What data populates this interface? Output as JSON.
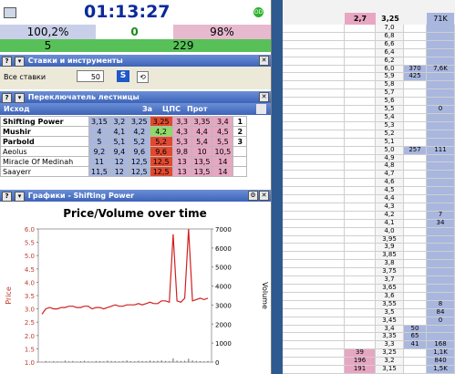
{
  "clock": "01:13:27",
  "stats": {
    "row1": [
      "100,2%",
      "0",
      "98%"
    ],
    "row2": [
      "5",
      "229"
    ]
  },
  "colors": {
    "panel_header": "#4a72c4",
    "blue_cell": "#a9b7df",
    "pink_cell": "#e7a6c2",
    "red_cell": "#e0492f",
    "green_cell": "#8fd86a",
    "green_bar": "#58c058"
  },
  "bets_panel": {
    "title": "Ставки и инструменты",
    "all_bets_label": "Все ставки",
    "stake": "50",
    "s_button": "S"
  },
  "ladder_panel": {
    "title": "Переключатель лестницы",
    "header": {
      "outcome": "Исход",
      "back": "За",
      "ltp": "ЦПС",
      "lay": "Прот"
    },
    "rows": [
      {
        "name": "Shifting Power",
        "bold": true,
        "vals": [
          "3,15",
          "3,2",
          "3,25",
          "3,25",
          "3,3",
          "3,35",
          "3,4"
        ],
        "rank": "1"
      },
      {
        "name": "Mushir",
        "bold": true,
        "vals": [
          "4",
          "4,1",
          "4,2",
          "4,2",
          "4,3",
          "4,4",
          "4,5"
        ],
        "rank": "2"
      },
      {
        "name": "Parbold",
        "bold": true,
        "vals": [
          "5",
          "5,1",
          "5,2",
          "5,2",
          "5,3",
          "5,4",
          "5,5"
        ],
        "rank": "3"
      },
      {
        "name": "Aeolus",
        "bold": false,
        "vals": [
          "9,2",
          "9,4",
          "9,6",
          "9,6",
          "9,8",
          "10",
          "10,5"
        ],
        "rank": ""
      },
      {
        "name": "Miracle Of Medinah",
        "bold": false,
        "vals": [
          "11",
          "12",
          "12,5",
          "12,5",
          "13",
          "13,5",
          "14"
        ],
        "rank": ""
      },
      {
        "name": "Saayerr",
        "bold": false,
        "vals": [
          "11,5",
          "12",
          "12,5",
          "12,5",
          "13",
          "13,5",
          "14"
        ],
        "rank": ""
      }
    ]
  },
  "graph_panel": {
    "title": "Графики - Shifting Power",
    "chart_title": "Price/Volume over time",
    "ylabel_left": "Price",
    "ylabel_right": "Volume",
    "left_ticks": [
      "6.0",
      "5.5",
      "5.0",
      "4.5",
      "4.0",
      "3.5",
      "3.0",
      "2.5",
      "2.0",
      "1.5",
      "1.0"
    ],
    "right_ticks": [
      "7000",
      "6000",
      "5000",
      "4000",
      "3000",
      "2000",
      "1000",
      "0"
    ]
  },
  "chart_data": {
    "type": "line",
    "title": "Price/Volume over time",
    "xlabel": "",
    "ylabel": "Price",
    "y2label": "Volume",
    "ylim": [
      1.0,
      6.0
    ],
    "y2lim": [
      0,
      7000
    ],
    "series": [
      {
        "name": "",
        "values": [
          2.8,
          3.0,
          3.05,
          3.0,
          3.0,
          3.05,
          3.05,
          3.1,
          3.1,
          3.05,
          3.05,
          3.1,
          3.1,
          3.0,
          3.05,
          3.05,
          3.0,
          3.05,
          3.1,
          3.15,
          3.1,
          3.1,
          3.15,
          3.15,
          3.15,
          3.2,
          3.15,
          3.2,
          3.25,
          3.2,
          3.2,
          3.3,
          3.3,
          3.25,
          5.8,
          3.3,
          3.25,
          3.4,
          6.0,
          3.3,
          3.35,
          3.4,
          3.35,
          3.4
        ]
      }
    ],
    "volume": [
      20,
      60,
      30,
      50,
      40,
      30,
      80,
      40,
      60,
      30,
      50,
      70,
      40,
      30,
      60,
      50,
      40,
      80,
      60,
      50,
      40,
      60,
      90,
      50,
      40,
      70,
      60,
      50,
      80,
      60,
      70,
      90,
      60,
      50,
      200,
      80,
      60,
      70,
      180,
      90,
      60,
      50,
      40,
      60
    ]
  },
  "right_grid": {
    "header": [
      "2,7",
      "3,25",
      "71K"
    ],
    "rows": [
      {
        "price": "7,0",
        "back": "",
        "vol": "",
        "tv": ""
      },
      {
        "price": "6,8",
        "back": "",
        "vol": "",
        "tv": ""
      },
      {
        "price": "6,6",
        "back": "",
        "vol": "",
        "tv": ""
      },
      {
        "price": "6,4",
        "back": "",
        "vol": "",
        "tv": ""
      },
      {
        "price": "6,2",
        "back": "",
        "vol": "",
        "tv": ""
      },
      {
        "price": "6,0",
        "back": "370",
        "vol": "7,6K",
        "tv": ""
      },
      {
        "price": "5,9",
        "back": "425",
        "vol": "",
        "tv": ""
      },
      {
        "price": "5,8",
        "back": "",
        "vol": "",
        "tv": ""
      },
      {
        "price": "5,7",
        "back": "",
        "vol": "",
        "tv": ""
      },
      {
        "price": "5,6",
        "back": "",
        "vol": "",
        "tv": ""
      },
      {
        "price": "5,5",
        "back": "",
        "vol": "0",
        "tv": ""
      },
      {
        "price": "5,4",
        "back": "",
        "vol": "",
        "tv": ""
      },
      {
        "price": "5,3",
        "back": "",
        "vol": "",
        "tv": ""
      },
      {
        "price": "5,2",
        "back": "",
        "vol": "",
        "tv": ""
      },
      {
        "price": "5,1",
        "back": "",
        "vol": "",
        "tv": ""
      },
      {
        "price": "5,0",
        "back": "257",
        "vol": "111",
        "tv": ""
      },
      {
        "price": "4,9",
        "back": "",
        "vol": "",
        "tv": ""
      },
      {
        "price": "4,8",
        "back": "",
        "vol": "",
        "tv": ""
      },
      {
        "price": "4,7",
        "back": "",
        "vol": "",
        "tv": ""
      },
      {
        "price": "4,6",
        "back": "",
        "vol": "",
        "tv": ""
      },
      {
        "price": "4,5",
        "back": "",
        "vol": "",
        "tv": ""
      },
      {
        "price": "4,4",
        "back": "",
        "vol": "",
        "tv": ""
      },
      {
        "price": "4,3",
        "back": "",
        "vol": "",
        "tv": ""
      },
      {
        "price": "4,2",
        "back": "",
        "vol": "7",
        "tv": ""
      },
      {
        "price": "4,1",
        "back": "",
        "vol": "34",
        "tv": ""
      },
      {
        "price": "4,0",
        "back": "",
        "vol": "",
        "tv": ""
      },
      {
        "price": "3,95",
        "back": "",
        "vol": "",
        "tv": ""
      },
      {
        "price": "3,9",
        "back": "",
        "vol": "",
        "tv": ""
      },
      {
        "price": "3,85",
        "back": "",
        "vol": "",
        "tv": ""
      },
      {
        "price": "3,8",
        "back": "",
        "vol": "",
        "tv": ""
      },
      {
        "price": "3,75",
        "back": "",
        "vol": "",
        "tv": ""
      },
      {
        "price": "3,7",
        "back": "",
        "vol": "",
        "tv": ""
      },
      {
        "price": "3,65",
        "back": "",
        "vol": "",
        "tv": ""
      },
      {
        "price": "3,6",
        "back": "",
        "vol": "",
        "tv": ""
      },
      {
        "price": "3,55",
        "back": "",
        "vol": "8",
        "tv": ""
      },
      {
        "price": "3,5",
        "back": "",
        "vol": "84",
        "tv": ""
      },
      {
        "price": "3,45",
        "back": "",
        "vol": "0",
        "tv": ""
      },
      {
        "price": "3,4",
        "back": "50",
        "vol": "",
        "tv": ""
      },
      {
        "price": "3,35",
        "back": "65",
        "vol": "",
        "tv": ""
      },
      {
        "price": "3,3",
        "back": "41",
        "vol": "168",
        "tv": ""
      },
      {
        "price": "3,25",
        "back": "",
        "vol": "1,1K",
        "tv": "39"
      },
      {
        "price": "3,2",
        "back": "",
        "vol": "840",
        "tv": "196"
      },
      {
        "price": "3,15",
        "back": "",
        "vol": "1,5K",
        "tv": "191"
      }
    ]
  }
}
